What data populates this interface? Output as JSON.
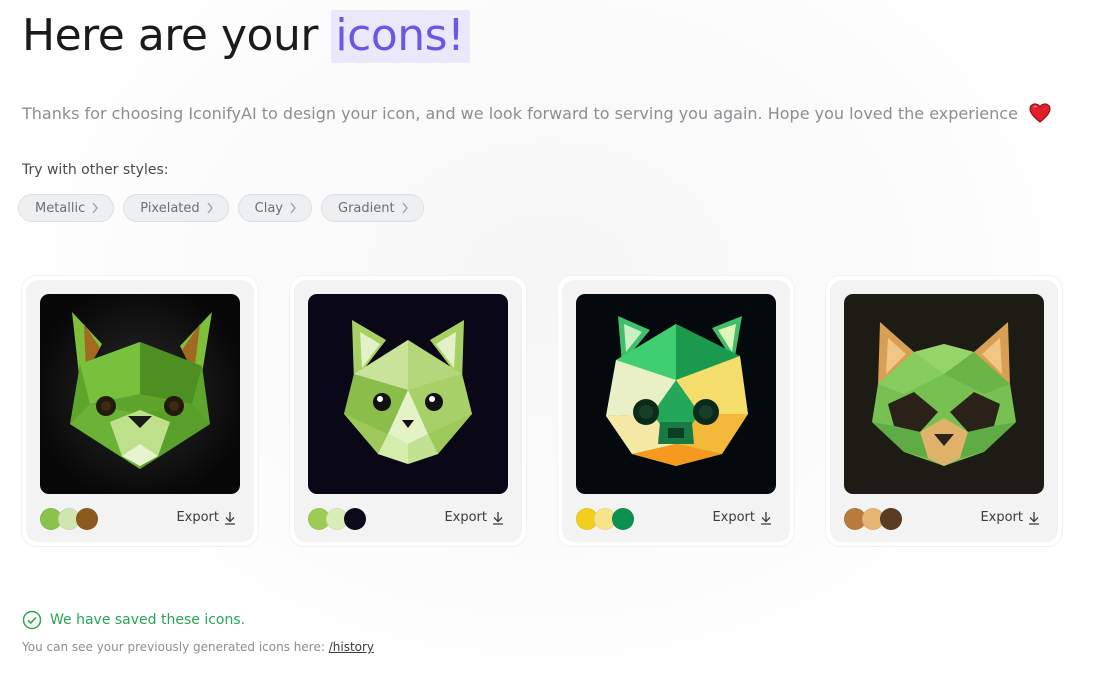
{
  "header": {
    "title_prefix": "Here are your",
    "title_highlight": "icons!",
    "subtitle": "Thanks for choosing IconifyAI to design your icon, and we look forward to serving you again. Hope you loved the experience"
  },
  "styles": {
    "label": "Try with other styles:",
    "chips": [
      "Metallic",
      "Pixelated",
      "Clay",
      "Gradient"
    ]
  },
  "cards": [
    {
      "export_label": "Export",
      "swatches": [
        "#8bc34a",
        "#cfe6b0",
        "#8b5a1e"
      ],
      "bg": "#0d0d0d",
      "icon": "green-fox-icon"
    },
    {
      "export_label": "Export",
      "swatches": [
        "#9ccc55",
        "#d9edb8",
        "#0c0a18"
      ],
      "bg": "#0a0716",
      "icon": "green-cat-icon"
    },
    {
      "export_label": "Export",
      "swatches": [
        "#f2cf1e",
        "#f6e48a",
        "#0d9050"
      ],
      "bg": "#04090e",
      "icon": "green-squirrel-icon"
    },
    {
      "export_label": "Export",
      "swatches": [
        "#b87b3c",
        "#e6b572",
        "#5a3c22"
      ],
      "bg": "#1c1b14",
      "icon": "green-raccoon-icon"
    }
  ],
  "footer": {
    "saved_message": "We have saved these icons.",
    "history_text": "You can see your previously generated icons here:",
    "history_link": "/history"
  },
  "colors": {
    "accent": "#6b57e6",
    "accent_bg": "#ece8fb",
    "success": "#28a551",
    "heart": "#e0202a"
  }
}
